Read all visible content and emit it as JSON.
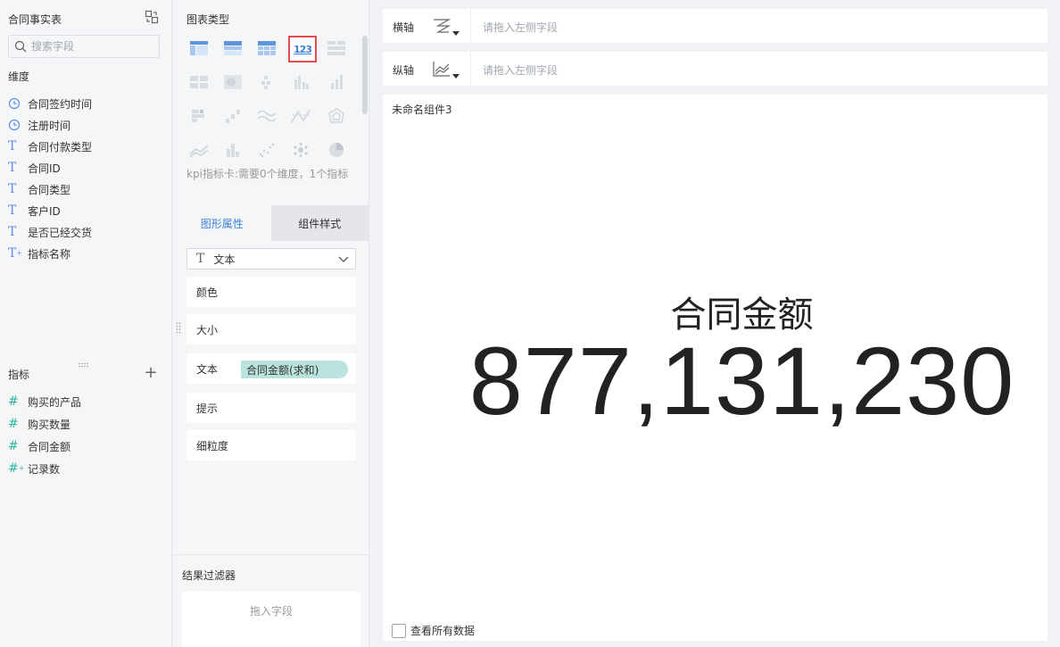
{
  "left": {
    "dataset_title": "合同事实表",
    "search_placeholder": "搜索字段",
    "dimensions_title": "维度",
    "dimensions": [
      {
        "label": "合同签约时间",
        "icon": "clock-icon"
      },
      {
        "label": "注册时间",
        "icon": "clock-icon"
      },
      {
        "label": "合同付款类型",
        "icon": "text-T-icon"
      },
      {
        "label": "合同ID",
        "icon": "text-T-icon"
      },
      {
        "label": "合同类型",
        "icon": "text-T-icon"
      },
      {
        "label": "客户ID",
        "icon": "text-T-icon"
      },
      {
        "label": "是否已经交货",
        "icon": "text-T-icon"
      },
      {
        "label": "指标名称",
        "icon": "text-T-calc-icon"
      }
    ],
    "measures_title": "指标",
    "add_symbol": "+",
    "measures": [
      {
        "label": "购买的产品",
        "icon": "hash-icon"
      },
      {
        "label": "购买数量",
        "icon": "hash-icon"
      },
      {
        "label": "合同金额",
        "icon": "hash-icon"
      },
      {
        "label": "记录数",
        "icon": "hash-calc-icon"
      }
    ]
  },
  "middle": {
    "chart_type_title": "图表类型",
    "kpi_glyph": "123",
    "chart_hint": "kpi指标卡:需要0个维度，1个指标",
    "tabs": [
      {
        "label": "图形属性",
        "active": true
      },
      {
        "label": "组件样式",
        "active": false
      }
    ],
    "mark_type": {
      "symbol": "T",
      "label": "文本"
    },
    "properties": {
      "color": "颜色",
      "size": "大小",
      "text": "文本",
      "text_field": "合同金额(求和)",
      "tooltip": "提示",
      "granularity": "细粒度"
    },
    "filter_title": "结果过滤器",
    "filter_drop": "拖入字段"
  },
  "axes": {
    "x_label": "横轴",
    "y_label": "纵轴",
    "placeholder": "请拖入左侧字段"
  },
  "canvas": {
    "component_title": "未命名组件3",
    "kpi_label": "合同金额",
    "kpi_value": "877,131,230",
    "view_all_data": "查看所有数据"
  },
  "colors": {
    "accent_blue": "#3a7ed6",
    "selection_red": "#e34c4c",
    "measure_teal": "#2fb7a5",
    "pill_bg": "#b9e3dc"
  }
}
